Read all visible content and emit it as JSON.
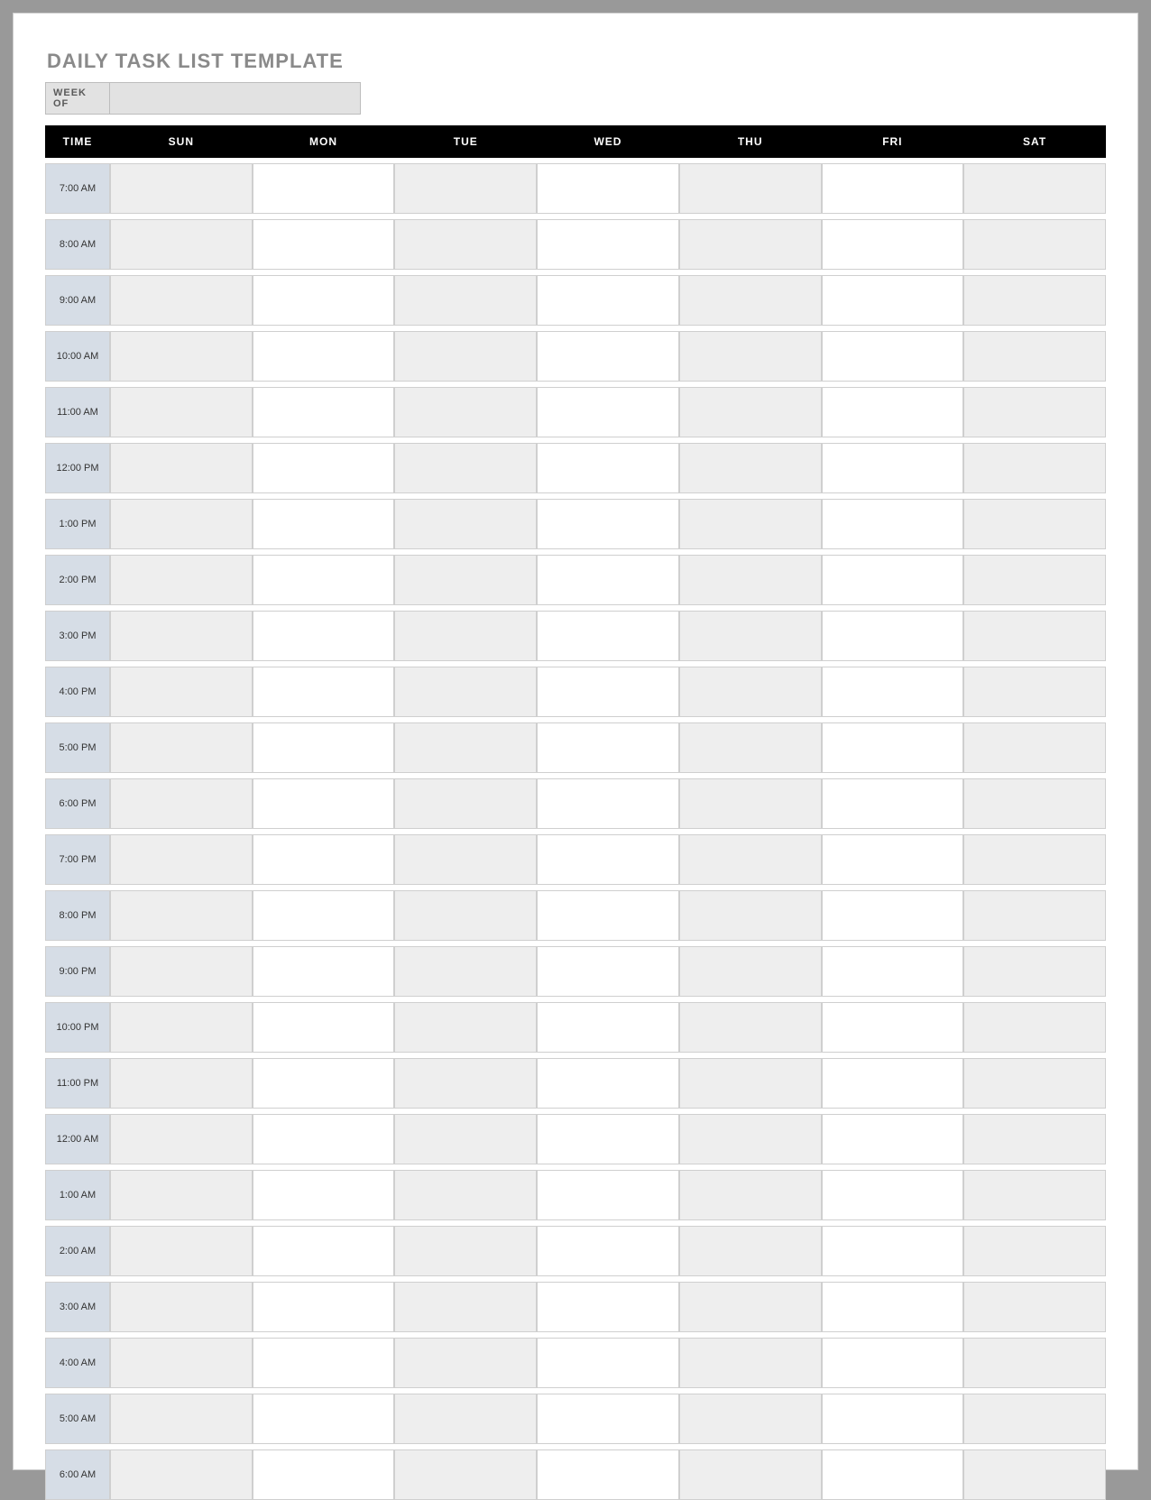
{
  "title": "DAILY TASK LIST TEMPLATE",
  "week_of_label": "WEEK OF",
  "week_of_value": "",
  "columns": {
    "time": "TIME",
    "days": [
      "SUN",
      "MON",
      "TUE",
      "WED",
      "THU",
      "FRI",
      "SAT"
    ]
  },
  "times": [
    "7:00 AM",
    "8:00 AM",
    "9:00 AM",
    "10:00 AM",
    "11:00 AM",
    "12:00 PM",
    "1:00 PM",
    "2:00 PM",
    "3:00 PM",
    "4:00 PM",
    "5:00 PM",
    "6:00 PM",
    "7:00 PM",
    "8:00 PM",
    "9:00 PM",
    "10:00 PM",
    "11:00 PM",
    "12:00 AM",
    "1:00 AM",
    "2:00 AM",
    "3:00 AM",
    "4:00 AM",
    "5:00 AM",
    "6:00 AM"
  ]
}
